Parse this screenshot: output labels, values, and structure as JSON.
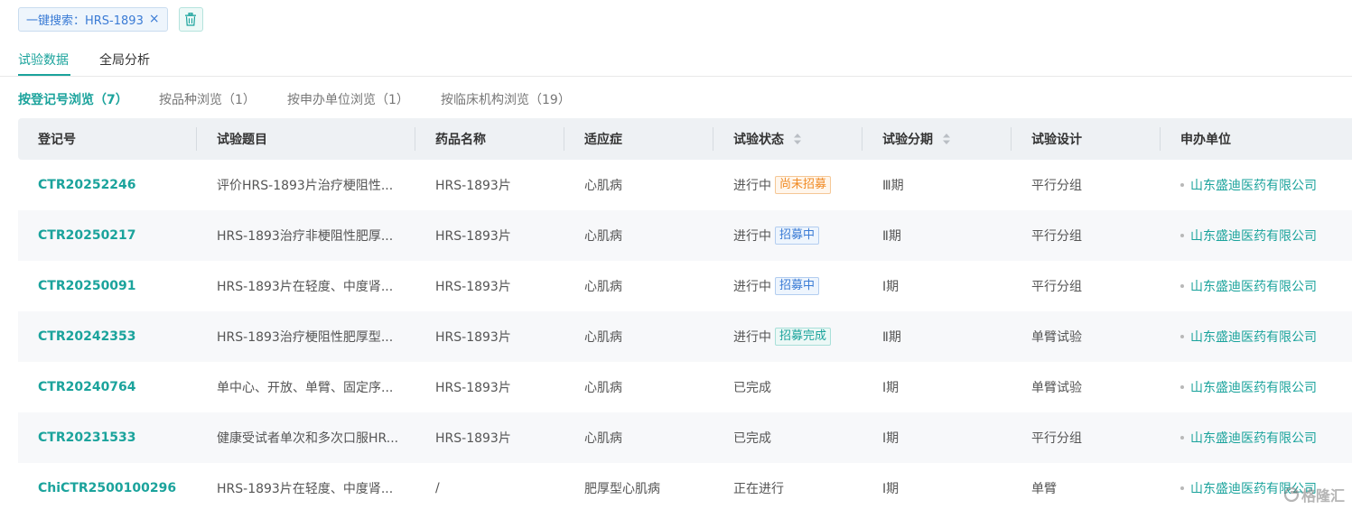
{
  "search": {
    "tag_label": "一键搜索：HRS-1893",
    "close_glyph": "×"
  },
  "tabs": [
    {
      "label": "试验数据",
      "active": true
    },
    {
      "label": "全局分析",
      "active": false
    }
  ],
  "sub_tabs": [
    {
      "label": "按登记号浏览（7）",
      "active": true
    },
    {
      "label": "按品种浏览（1）",
      "active": false
    },
    {
      "label": "按申办单位浏览（1）",
      "active": false
    },
    {
      "label": "按临床机构浏览（19）",
      "active": false
    }
  ],
  "table": {
    "headers": [
      "登记号",
      "试验题目",
      "药品名称",
      "适应症",
      "试验状态",
      "试验分期",
      "试验设计",
      "申办单位"
    ],
    "rows": [
      {
        "reg": "CTR20252246",
        "title": "评价HRS-1893片治疗梗阻性...",
        "drug": "HRS-1893片",
        "indication": "心肌病",
        "status": "进行中",
        "badge": "尚未招募",
        "badge_color": "orange",
        "phase": "Ⅲ期",
        "design": "平行分组",
        "sponsor": "山东盛迪医药有限公司"
      },
      {
        "reg": "CTR20250217",
        "title": "HRS-1893治疗非梗阻性肥厚...",
        "drug": "HRS-1893片",
        "indication": "心肌病",
        "status": "进行中",
        "badge": "招募中",
        "badge_color": "blue",
        "phase": "Ⅱ期",
        "design": "平行分组",
        "sponsor": "山东盛迪医药有限公司"
      },
      {
        "reg": "CTR20250091",
        "title": "HRS-1893片在轻度、中度肾...",
        "drug": "HRS-1893片",
        "indication": "心肌病",
        "status": "进行中",
        "badge": "招募中",
        "badge_color": "blue",
        "phase": "Ⅰ期",
        "design": "平行分组",
        "sponsor": "山东盛迪医药有限公司"
      },
      {
        "reg": "CTR20242353",
        "title": "HRS-1893治疗梗阻性肥厚型...",
        "drug": "HRS-1893片",
        "indication": "心肌病",
        "status": "进行中",
        "badge": "招募完成",
        "badge_color": "green",
        "phase": "Ⅱ期",
        "design": "单臂试验",
        "sponsor": "山东盛迪医药有限公司"
      },
      {
        "reg": "CTR20240764",
        "title": "单中心、开放、单臂、固定序...",
        "drug": "HRS-1893片",
        "indication": "心肌病",
        "status": "已完成",
        "badge": "",
        "badge_color": "",
        "phase": "Ⅰ期",
        "design": "单臂试验",
        "sponsor": "山东盛迪医药有限公司"
      },
      {
        "reg": "CTR20231533",
        "title": "健康受试者单次和多次口服HR...",
        "drug": "HRS-1893片",
        "indication": "心肌病",
        "status": "已完成",
        "badge": "",
        "badge_color": "",
        "phase": "Ⅰ期",
        "design": "平行分组",
        "sponsor": "山东盛迪医药有限公司"
      },
      {
        "reg": "ChiCTR2500100296",
        "title": "HRS-1893片在轻度、中度肾...",
        "drug": "/",
        "indication": "肥厚型心肌病",
        "status": "正在进行",
        "badge": "",
        "badge_color": "",
        "phase": "Ⅰ期",
        "design": "单臂",
        "sponsor": "山东盛迪医药有限公司"
      }
    ]
  },
  "watermark": {
    "text": "格隆汇"
  },
  "colors": {
    "accent": "#1ba39c",
    "link_blue": "#3a7bd5",
    "header_bg": "#eef1f4"
  }
}
